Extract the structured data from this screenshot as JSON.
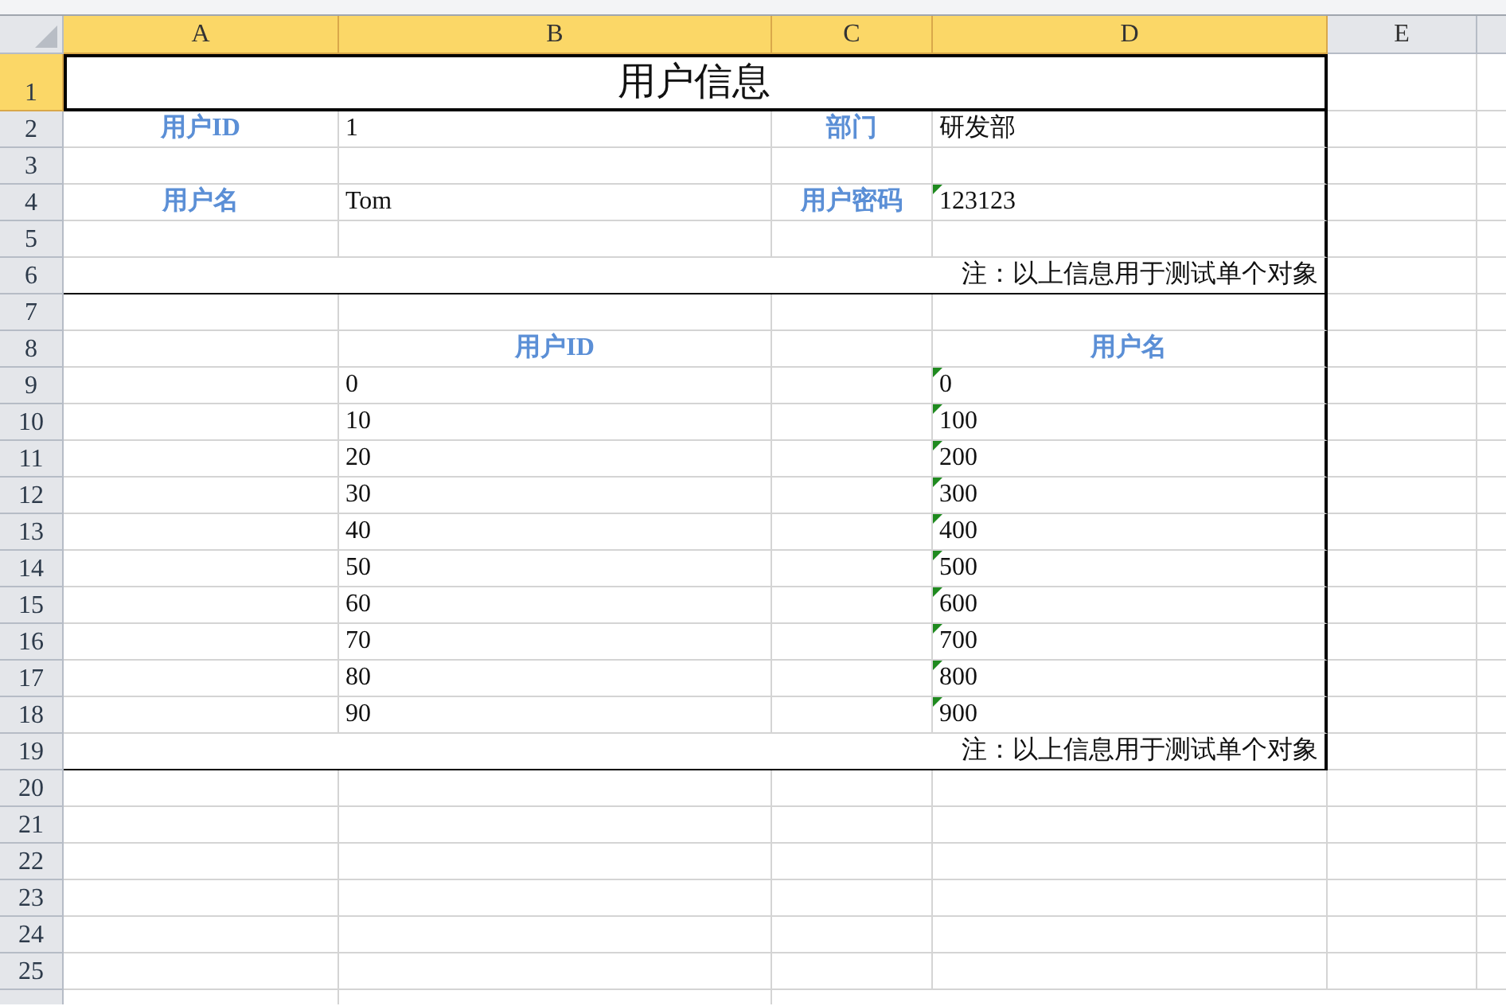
{
  "columns": [
    {
      "label": "A",
      "selected": true
    },
    {
      "label": "B",
      "selected": true
    },
    {
      "label": "C",
      "selected": true
    },
    {
      "label": "D",
      "selected": true
    },
    {
      "label": "E",
      "selected": false
    }
  ],
  "rows": [
    {
      "label": "1",
      "selected": true,
      "boxed": true,
      "bottom_rule": true,
      "cells": [
        {
          "kind": "title",
          "text": "用户信息"
        }
      ]
    },
    {
      "label": "2",
      "selected": false,
      "boxed": true,
      "bottom_rule": false,
      "cells": [
        {
          "kind": "label",
          "text": "用户ID"
        },
        {
          "kind": "value",
          "text": "1"
        },
        {
          "kind": "label",
          "text": "部门"
        },
        {
          "kind": "value",
          "text": "研发部"
        }
      ]
    },
    {
      "label": "3",
      "selected": false,
      "boxed": true,
      "bottom_rule": false
    },
    {
      "label": "4",
      "selected": false,
      "boxed": true,
      "bottom_rule": false,
      "cells": [
        {
          "kind": "label",
          "text": "用户名"
        },
        {
          "kind": "value",
          "text": "Tom"
        },
        {
          "kind": "label",
          "text": "用户密码"
        },
        {
          "kind": "text_value",
          "text": "123123"
        }
      ]
    },
    {
      "label": "5",
      "selected": false,
      "boxed": true,
      "bottom_rule": false
    },
    {
      "label": "6",
      "selected": false,
      "boxed": true,
      "bottom_rule": true,
      "cells": [
        {
          "kind": "note",
          "text": "注：以上信息用于测试单个对象"
        }
      ]
    },
    {
      "label": "7",
      "selected": false,
      "boxed": true,
      "bottom_rule": false
    },
    {
      "label": "8",
      "selected": false,
      "boxed": true,
      "bottom_rule": false,
      "cells": [
        null,
        {
          "kind": "label",
          "text": "用户ID"
        },
        null,
        {
          "kind": "label",
          "text": "用户名"
        }
      ]
    },
    {
      "label": "9",
      "selected": false,
      "boxed": true,
      "bottom_rule": false,
      "cells": [
        null,
        {
          "kind": "value",
          "text": "0"
        },
        null,
        {
          "kind": "text_value",
          "text": "0"
        }
      ]
    },
    {
      "label": "10",
      "selected": false,
      "boxed": true,
      "bottom_rule": false,
      "cells": [
        null,
        {
          "kind": "value",
          "text": "10"
        },
        null,
        {
          "kind": "text_value",
          "text": "100"
        }
      ]
    },
    {
      "label": "11",
      "selected": false,
      "boxed": true,
      "bottom_rule": false,
      "cells": [
        null,
        {
          "kind": "value",
          "text": "20"
        },
        null,
        {
          "kind": "text_value",
          "text": "200"
        }
      ]
    },
    {
      "label": "12",
      "selected": false,
      "boxed": true,
      "bottom_rule": false,
      "cells": [
        null,
        {
          "kind": "value",
          "text": "30"
        },
        null,
        {
          "kind": "text_value",
          "text": "300"
        }
      ]
    },
    {
      "label": "13",
      "selected": false,
      "boxed": true,
      "bottom_rule": false,
      "cells": [
        null,
        {
          "kind": "value",
          "text": "40"
        },
        null,
        {
          "kind": "text_value",
          "text": "400"
        }
      ]
    },
    {
      "label": "14",
      "selected": false,
      "boxed": true,
      "bottom_rule": false,
      "cells": [
        null,
        {
          "kind": "value",
          "text": "50"
        },
        null,
        {
          "kind": "text_value",
          "text": "500"
        }
      ]
    },
    {
      "label": "15",
      "selected": false,
      "boxed": true,
      "bottom_rule": false,
      "cells": [
        null,
        {
          "kind": "value",
          "text": "60"
        },
        null,
        {
          "kind": "text_value",
          "text": "600"
        }
      ]
    },
    {
      "label": "16",
      "selected": false,
      "boxed": true,
      "bottom_rule": false,
      "cells": [
        null,
        {
          "kind": "value",
          "text": "70"
        },
        null,
        {
          "kind": "text_value",
          "text": "700"
        }
      ]
    },
    {
      "label": "17",
      "selected": false,
      "boxed": true,
      "bottom_rule": false,
      "cells": [
        null,
        {
          "kind": "value",
          "text": "80"
        },
        null,
        {
          "kind": "text_value",
          "text": "800"
        }
      ]
    },
    {
      "label": "18",
      "selected": false,
      "boxed": true,
      "bottom_rule": false,
      "cells": [
        null,
        {
          "kind": "value",
          "text": "90"
        },
        null,
        {
          "kind": "text_value",
          "text": "900"
        }
      ]
    },
    {
      "label": "19",
      "selected": false,
      "boxed": true,
      "bottom_rule": true,
      "cells": [
        {
          "kind": "note",
          "text": "注：以上信息用于测试单个对象"
        }
      ]
    },
    {
      "label": "20",
      "selected": false,
      "boxed": false,
      "bottom_rule": false
    },
    {
      "label": "21",
      "selected": false,
      "boxed": false,
      "bottom_rule": false
    },
    {
      "label": "22",
      "selected": false,
      "boxed": false,
      "bottom_rule": false
    },
    {
      "label": "23",
      "selected": false,
      "boxed": false,
      "bottom_rule": false
    },
    {
      "label": "24",
      "selected": false,
      "boxed": false,
      "bottom_rule": false
    },
    {
      "label": "25",
      "selected": false,
      "boxed": false,
      "bottom_rule": false
    }
  ]
}
